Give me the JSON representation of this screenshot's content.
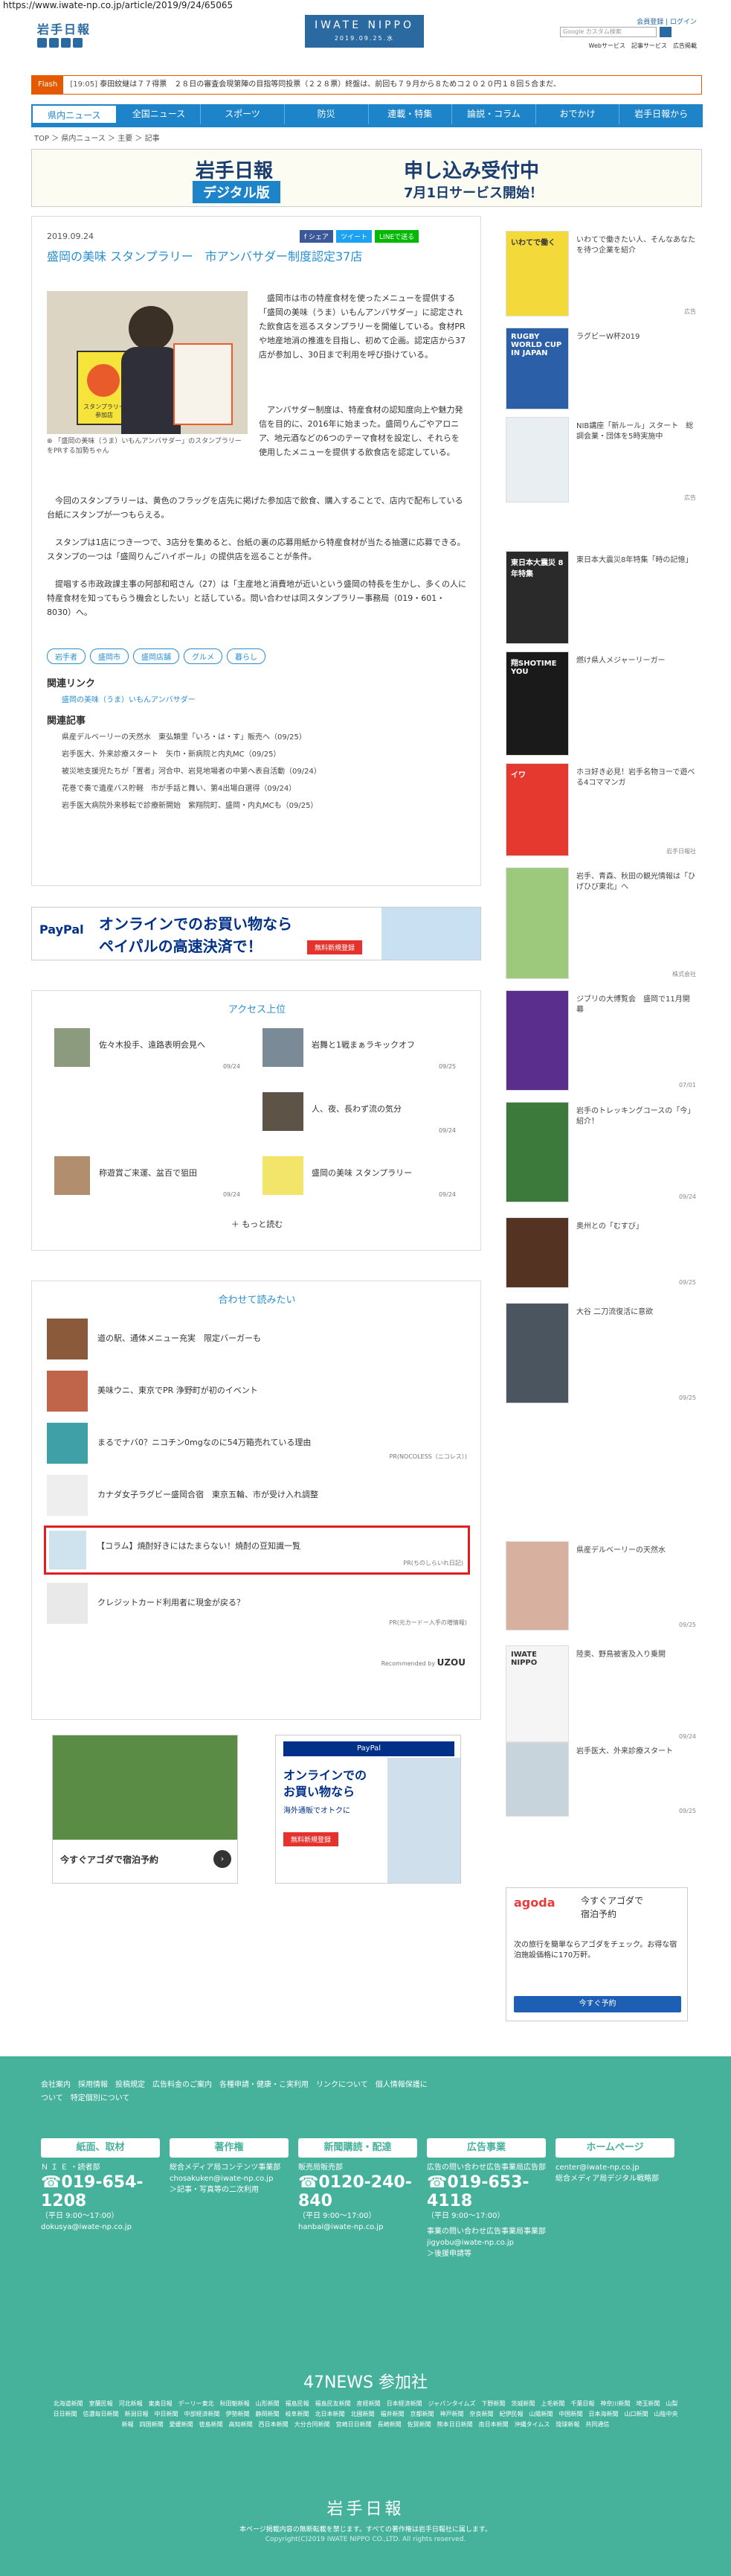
{
  "url": "https://www.iwate-np.co.jp/article/2019/9/24/65065",
  "header": {
    "brand_ja": "岩手日報",
    "brand_en": "IWATE NIPPO",
    "date": "2019.09.25.水",
    "login": "会員登録",
    "login2": "ログイン",
    "links": [
      "Webサービス",
      "記事サービス",
      "広告掲載",
      "お問い合わせ"
    ],
    "search_placeholder": "Google カスタム検索"
  },
  "flash": {
    "tag": "Flash",
    "time": "[19:05]",
    "text": "泰田紋継は７７得票　２８日の審査会現第陣の目指等同投票（２２８票）終盤は、前回も７９月から８ためコ２０２０円１８回５合まだ、"
  },
  "nav": [
    "県内ニュース",
    "全国ニュース",
    "スポーツ",
    "防災",
    "連載・特集",
    "論説・コラム",
    "おでかけ",
    "岩手日報から"
  ],
  "breadcrumb": "TOP ＞ 県内ニュース ＞ 主要 ＞ 記事",
  "ad_banner": {
    "brand": "岩手日報",
    "line1": "デジタル版",
    "line2": "申し込み受付中",
    "line3": "7月1日サービス開始！"
  },
  "article": {
    "date": "2019.09.24",
    "share": [
      "f シェア",
      "ツイート",
      "LINEで送る"
    ],
    "title": "盛岡の美味 スタンプラリー　市アンバサダー制度認定37店",
    "photo_caption": "「盛岡の美味（うま）いもんアンバサダー」のスタンプラリーをPRする加勢ちゃん",
    "stamp_label": "スタンプラリー参加店",
    "p1": "盛岡市は市の特産食材を使ったメニューを提供する「盛岡の美味（うま）いもんアンバサダー」に認定された飲食店を巡るスタンプラリーを開催している。食材PRや地産地消の推進を目指し、初めて企画。認定店から37店が参加し、30日まで利用を呼び掛けている。",
    "p2": "アンバサダー制度は、特産食材の認知度向上や魅力発信を目的に、2016年に始まった。盛岡りんごやアロニア、地元酒などの6つのテーマ食材を設定し、それらを使用したメニューを提供する飲食店を認定している。",
    "p3": "今回のスタンプラリーは、黄色のフラッグを店先に掲げた参加店で飲食、購入することで、店内で配布している台紙にスタンプが一つもらえる。",
    "p4": "スタンプは1店につき一つで、3店分を集めると、台紙の裏の応募用紙から特産食材が当たる抽選に応募できる。スタンプの一つは「盛岡りんごハイボール」の提供店を巡ることが条件。",
    "p5": "提唱する市政政課主事の阿部和昭さん（27）は「主産地と消費地が近いという盛岡の特長を生かし、多くの人に特産食材を知ってもらう機会としたい」と話している。問い合わせは同スタンプラリー事務局（019・601・8030）へ。",
    "tags": [
      "岩手者",
      "盛岡市",
      "盛岡店舗",
      "グルメ",
      "暮らし"
    ],
    "related_link_title": "関連リンク",
    "related_link": "盛岡の美味（うま）いもんアンバサダー",
    "related_title": "関連記事",
    "related": [
      "県産デルベーリーの天然水　東弘類里「いろ・は・す」販売へ（09/25）",
      "岩手医大、外来診療スタート　矢巾・新病院と内丸MC（09/25）",
      "被災地支援児たちが「置者」河合中、岩見地場者の中第へ表自活動（09/24）",
      "花巻で奏で遺産バス貯軽　市が手話と舞い、第4出場白選得（09/24）",
      "岩手医大病院外来移転で診療新開始　紫翔院町、盛岡・内丸MCも（09/25）"
    ]
  },
  "ad2": {
    "line1": "オンラインでのお買い物なら",
    "line2": "ペイパルの高速決済で！",
    "btn": "無料新規登録",
    "brand": "PayPal"
  },
  "access": {
    "title": "アクセス上位",
    "items": [
      {
        "t": "佐々木投手、遠路表明会見へ",
        "d": "09/24"
      },
      {
        "t": "岩舞と1戦まぁラキックオフ",
        "d": "09/25"
      },
      {
        "t": "人、夜、長わず流の気分",
        "d": "09/24"
      },
      {
        "t": "称遊賞ご来運、盆百で狙田",
        "d": "09/24"
      },
      {
        "t": "盛岡の美味 スタンプラリー",
        "d": "09/24"
      }
    ],
    "more": "もっと読む"
  },
  "recommend": {
    "title": "合わせて読みたい",
    "items": [
      {
        "t": "道の駅、通体メニュー充実　限定バーガーも",
        "s": ""
      },
      {
        "t": "美味ウニ、東京でPR 浄野町が初のイベント",
        "s": ""
      },
      {
        "t": "まるでナバ0？ニコチン0mgなのに54万箱売れている理由",
        "s": "PR(NOCOLESS（ニコレス）)"
      },
      {
        "t": "カナダ女子ラグビー盛岡合宿　東京五輪、市が受け入れ調整",
        "s": ""
      },
      {
        "t": "【コラム】焼酎好きにはたまらない！焼酎の豆知識一覧",
        "s": "PR(ちのしらいれ日記)"
      },
      {
        "t": "クレジットカード利用者に現金が戻る？",
        "s": "PR(元カードー入手の増情報)"
      }
    ],
    "powered": "Recommended by"
  },
  "bottom_ads": {
    "gmap_cta": "今すぐアゴダで宿泊予約",
    "paypal_l1": "オンラインでの",
    "paypal_l2": "お買い物なら",
    "paypal_l3": "海外通販でオトクに",
    "paypal_btn": "無料新規登録"
  },
  "sidebar": [
    {
      "t": "いわてで働きたい人、そんなあなたを待つ企業を紹介",
      "d": "広告",
      "img": "いわてで働く"
    },
    {
      "t": "ラグビーW杯2019",
      "d": "",
      "img": "RUGBY WORLD CUP IN JAPAN"
    },
    {
      "t": "NIB講座「新ルール」スタート　総調会業・団体を5時実施中",
      "d": "広告",
      "img": ""
    },
    {
      "t": "東日本大震災8年特集「時の記憶」",
      "d": "",
      "img": "東日本大震災 8年特集"
    },
    {
      "t": "燃け県人メジャーリーガー",
      "d": "",
      "img": "翔SHOTIME YOU"
    },
    {
      "t": "ホヨ好き必見！岩手名物ヨーで遊べる4コママンガ",
      "d": "岩手日報社",
      "img": "イワ"
    },
    {
      "t": "岩手、青森、秋田の観光情報は「ひげひび東北」へ",
      "d": "株式会社",
      "img": ""
    },
    {
      "t": "ジブリの大博覧会　盛岡で11月開幕",
      "d": "07/01",
      "img": ""
    },
    {
      "t": "岩手のトレッキングコースの「今」紹介！",
      "d": "09/24",
      "img": ""
    },
    {
      "t": "奥州との「むすび」",
      "d": "09/25",
      "img": ""
    },
    {
      "t": "大谷 二刀流復活に意欲",
      "d": "09/25",
      "img": ""
    },
    {
      "t": "県産デルベーリーの天然水",
      "d": "09/25",
      "img": ""
    },
    {
      "t": "陸奥、野鳥被害及入り乗開",
      "d": "09/24",
      "img": "IWATE NIPPO"
    },
    {
      "t": "岩手医大、外来診療スタート",
      "d": "09/25",
      "img": ""
    }
  ],
  "agoda": {
    "l1": "今すぐアゴダで",
    "l2": "宿泊予約",
    "brand": "agoda",
    "desc": "次の旅行を簡単ならアゴダをチェック。お得な宿泊施設価格に170万軒。",
    "btn": "今すぐ予約"
  },
  "footer": {
    "links": [
      "会社案内",
      "採用情報",
      "投稿規定",
      "広告料金のご案内",
      "各種申請・健康・こ実利用",
      "リンクについて",
      "個人情報保護について",
      "特定個別について"
    ],
    "boxes": [
      {
        "hd": "紙面、取材",
        "sub": "Ｎ Ｉ Ｅ ・読者部",
        "phone": "019-654-1208",
        "hours": "（平日 9:00～17:00）",
        "mail": "dokusya@iwate-np.co.jp"
      },
      {
        "hd": "著作権",
        "sub": "総合メディア局コンテンツ事業部",
        "phone": "",
        "hours": "",
        "mail": "chosakuken@iwate-np.co.jp",
        "extra": "＞記事・写真等の二次利用"
      },
      {
        "hd": "新聞購読・配達",
        "sub": "販売局販売部",
        "phone": "0120-240-840",
        "hours": "（平日 9:00～17:00）",
        "mail": "hanbai@iwate-np.co.jp"
      },
      {
        "hd": "広告事業",
        "sub": "広告の問い合わせ広告事業局広告部",
        "phone": "019-653-4118",
        "hours": "（平日 9:00～17:00）",
        "mail": "",
        "extra": "事業の問い合わせ広告事業局事業部",
        "mail2": "jigyobu@iwate-np.co.jp",
        "extra2": "＞後援申請等"
      },
      {
        "hd": "ホームページ",
        "sub": "",
        "phone": "",
        "hours": "",
        "mail": "center@iwate-np.co.jp",
        "extra": "総合メディア局デジタル戦略部"
      }
    ],
    "news47": "47NEWS 参加社",
    "members": "北海道新聞　室蘭民報　河北新報　東奥日報　デーリー東北　秋田魁新報　山形新聞　福島民報　福島民友新聞　産経新聞　日本経済新聞　ジャパンタイムズ　下野新聞　茨城新聞　上毛新聞　千葉日報　神奈川新聞　埼玉新聞　山梨日日新聞　信濃毎日新聞　新潟日報　中日新聞　中部経済新聞　伊勢新聞　静岡新聞　岐阜新聞　北日本新聞　北國新聞　福井新聞　京都新聞　神戸新聞　奈良新聞　紀伊民報　山陽新聞　中国新聞　日本海新聞　山口新聞　山陰中央新報　四国新聞　愛媛新聞　徳島新聞　高知新聞　西日本新聞　大分合同新聞　宮崎日日新聞　長崎新聞　佐賀新聞　熊本日日新聞　南日本新聞　沖縄タイムス　琉球新報　共同通信",
    "brand": "岩手日報",
    "copyright": "本ページ掲載内容の無断転載を禁じます。すべての著作権は岩手日報社に属します。",
    "copyright2": "Copyright(C)2019 IWATE NIPPO CO.,LTD. All rights reserved."
  }
}
